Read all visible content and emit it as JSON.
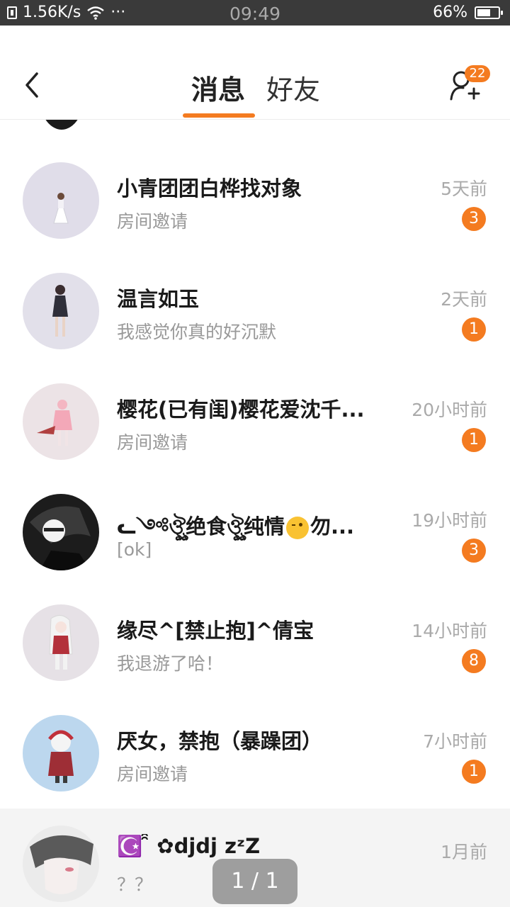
{
  "status_bar": {
    "speed": "1.56K/s",
    "more": "···",
    "time": "09:49",
    "battery_text": "66%",
    "battery_level": 0.66
  },
  "header": {
    "tabs": [
      {
        "label": "消息",
        "active": true
      },
      {
        "label": "好友",
        "active": false
      }
    ],
    "friend_request_count": "22",
    "accent_color": "#f47b20"
  },
  "conversations": [
    {
      "name": "小青团团白桦找对象",
      "preview": "房间邀请",
      "time": "5天前",
      "unread": "3"
    },
    {
      "name": "温言如玉",
      "preview": "我感觉你真的好沉默",
      "time": "2天前",
      "unread": "1"
    },
    {
      "name": "樱花(已有闺)樱花爱沈千...",
      "preview": "房间邀请",
      "time": "20小时前",
      "unread": "1"
    },
    {
      "name_prefix": "ᓚ༺ঔৣ绝食ঔৣ纯情",
      "name_suffix": "勿...",
      "preview": "[ok]",
      "time": "19小时前",
      "unread": "3"
    },
    {
      "name": "缘尽^[禁止抱]^倩宝",
      "preview": "我退游了哈！",
      "time": "14小时前",
      "unread": "8"
    },
    {
      "name": "厌女，禁抱（暴躁团）",
      "preview": "房间邀请",
      "time": "7小时前",
      "unread": "1"
    },
    {
      "name": "☪️ ̑̑ ✿djdj zᶻZ",
      "preview": "？？",
      "time": "1月前",
      "unread": ""
    }
  ],
  "pager": "1 / 1"
}
